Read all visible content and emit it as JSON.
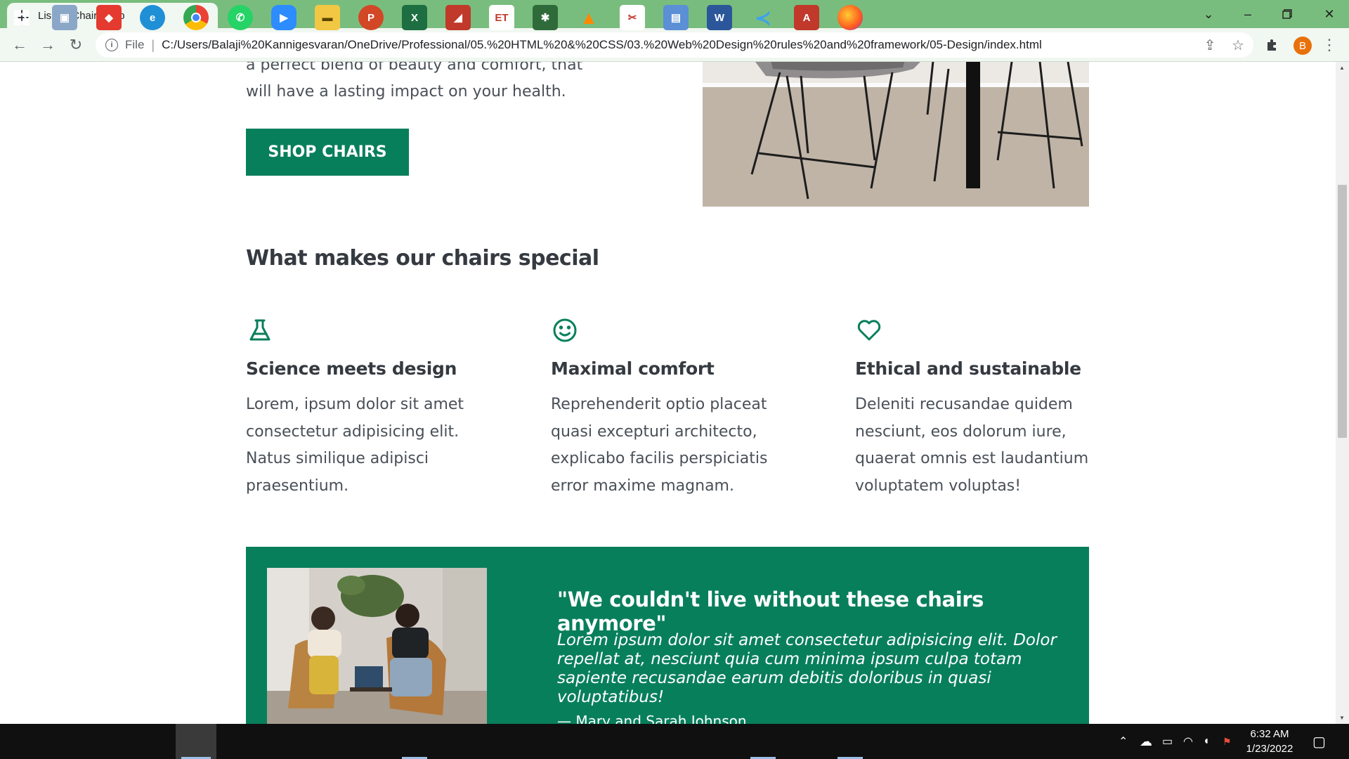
{
  "browser": {
    "tab_title": "Lisbon Chair Shop",
    "url_scheme": "File",
    "url": "C:/Users/Balaji%20Kannigesvaran/OneDrive/Professional/05.%20HTML%20&%20CSS/03.%20Web%20Design%20rules%20and%20framework/05-Design/index.html",
    "profile_initial": "B"
  },
  "hero": {
    "text": "a perfect blend of beauty and comfort, that will have a lasting impact on your health.",
    "cta_label": "SHOP CHAIRS"
  },
  "features_section": {
    "title": "What makes our chairs special",
    "items": [
      {
        "icon": "flask-icon",
        "title": "Science meets design",
        "text": "Lorem, ipsum dolor sit amet consectetur adipisicing elit. Natus similique adipisci praesentium."
      },
      {
        "icon": "smile-icon",
        "title": "Maximal comfort",
        "text": "Reprehenderit optio placeat quasi excepturi architecto, explicabo facilis perspiciatis error maxime magnam."
      },
      {
        "icon": "heart-icon",
        "title": "Ethical and sustainable",
        "text": "Deleniti recusandae quidem nesciunt, eos dolorum iure, quaerat omnis est laudantium voluptatem voluptas!"
      }
    ]
  },
  "testimonial": {
    "quote": "\"We couldn't live without these chairs anymore\"",
    "text": "Lorem ipsum dolor sit amet consectetur adipisicing elit. Dolor repellat at, nesciunt quia cum minima ipsum culpa totam sapiente recusandae earum debitis doloribus in quasi voluptatibus!",
    "author": "— Mary and Sarah Johnson"
  },
  "taskbar": {
    "clock_time": "6:32 AM",
    "clock_date": "1/23/2022"
  },
  "colors": {
    "brand": "#087f5b",
    "tab_strip": "#79bd7e"
  }
}
